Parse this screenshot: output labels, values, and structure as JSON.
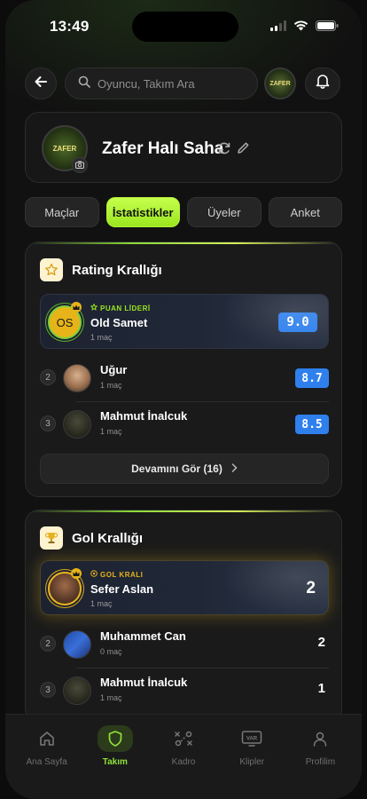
{
  "status": {
    "time": "13:49"
  },
  "search": {
    "placeholder": "Oyuncu, Takım Ara"
  },
  "team": {
    "name": "Zafer Halı Saha",
    "logo_text": "ZAFER"
  },
  "tabs": [
    {
      "label": "Maçlar"
    },
    {
      "label": "İstatistikler",
      "active": true
    },
    {
      "label": "Üyeler"
    },
    {
      "label": "Anket"
    }
  ],
  "rating": {
    "title": "Rating Krallığı",
    "leader": {
      "tag": "PUAN LİDERİ",
      "initials": "OS",
      "name": "Old Samet",
      "matches": "1 maç",
      "score": "9.0"
    },
    "rows": [
      {
        "rank": "2",
        "name": "Uğur",
        "matches": "1 maç",
        "score": "8.7"
      },
      {
        "rank": "3",
        "name": "Mahmut İnalcuk",
        "matches": "1 maç",
        "score": "8.5"
      }
    ],
    "more_label": "Devamını Gör (16)"
  },
  "goals": {
    "title": "Gol Krallığı",
    "leader": {
      "tag": "GOL KRALI",
      "name": "Sefer Aslan",
      "matches": "1 maç",
      "value": "2"
    },
    "rows": [
      {
        "rank": "2",
        "name": "Muhammet Can",
        "matches": "0 maç",
        "value": "2"
      },
      {
        "rank": "3",
        "name": "Mahmut İnalcuk",
        "matches": "1 maç",
        "value": "1"
      }
    ]
  },
  "nav": [
    {
      "label": "Ana Sayfa",
      "icon": "home-icon"
    },
    {
      "label": "Takım",
      "icon": "shield-icon",
      "active": true
    },
    {
      "label": "Kadro",
      "icon": "tactics-icon"
    },
    {
      "label": "Klipler",
      "icon": "var-icon"
    },
    {
      "label": "Profilim",
      "icon": "person-icon"
    }
  ],
  "colors": {
    "accent": "#9be61f",
    "score_blue": "#2f80ed",
    "gold": "#e6b419"
  }
}
